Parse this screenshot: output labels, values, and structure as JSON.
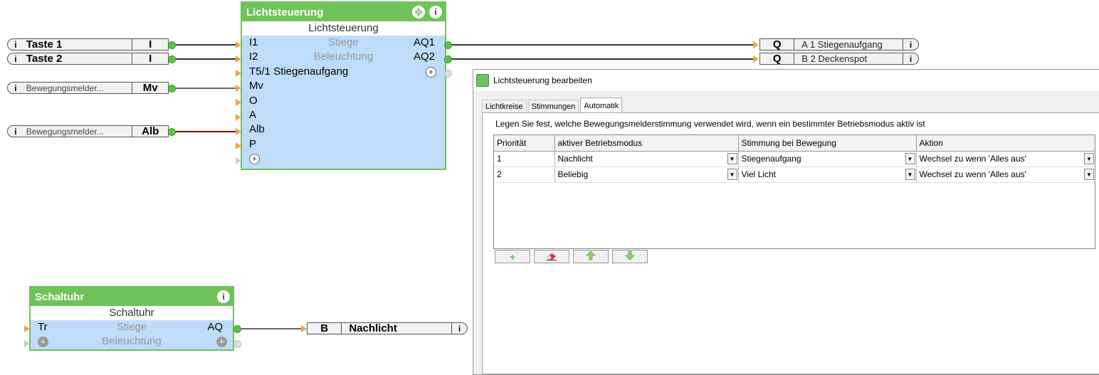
{
  "canvas": {
    "inputs": [
      {
        "name": "Taste 1",
        "port": "I"
      },
      {
        "name": "Taste 2",
        "port": "I"
      },
      {
        "name": "Bewegungsmelder...",
        "port": "Mv"
      },
      {
        "name": "Bewegungsmelder...",
        "port": "Alb"
      }
    ],
    "outputs": [
      {
        "port": "Q",
        "name": "A 1 Stiegenaufgang"
      },
      {
        "port": "Q",
        "name": "B 2 Deckenspot"
      },
      {
        "port": "B",
        "name": "Nachlicht"
      }
    ],
    "lichtsteuerung_block": {
      "header": "Lichtsteuerung",
      "title": "Lichtsteuerung",
      "rows": [
        {
          "left": "I1",
          "mid": "Stiege",
          "right": "AQ1"
        },
        {
          "left": "I2",
          "mid": "Beleuchtung",
          "right": "AQ2"
        },
        {
          "left": "T5/1 Stiegenaufgang",
          "mid": "",
          "right": "+"
        },
        {
          "left": "Mv",
          "mid": "",
          "right": ""
        },
        {
          "left": "O",
          "mid": "",
          "right": ""
        },
        {
          "left": "A",
          "mid": "",
          "right": ""
        },
        {
          "left": "Alb",
          "mid": "",
          "right": ""
        },
        {
          "left": "P",
          "mid": "",
          "right": ""
        },
        {
          "left": "+",
          "mid": "",
          "right": ""
        }
      ]
    },
    "schaltuhr_block": {
      "header": "Schaltuhr",
      "title": "Schaltuhr",
      "rows": [
        {
          "left": "Tr",
          "mid": "Stiege",
          "right": "AQ"
        },
        {
          "left": "+",
          "mid": "Beleuchtung",
          "right": "+"
        }
      ]
    },
    "icons": {
      "info": "info-icon",
      "move": "move-icon",
      "plus": "plus-icon"
    },
    "colors": {
      "block_green": "#6fc35a",
      "block_body": "#bfdcfb",
      "wire_alb": "#8b0000",
      "connector_orange": "#f0a44a"
    }
  },
  "dialog": {
    "title": "Lichtsteuerung bearbeiten",
    "tabs": [
      "Lichtkreise",
      "Stimmungen",
      "Automatik"
    ],
    "active_tab": "Automatik",
    "description": "Legen Sie fest, welche Bewegungsmelderstimmung verwendet wird, wenn ein bestimmter Betriebsmodus aktiv ist",
    "columns": [
      "Priorität",
      "aktiver Betriebsmodus",
      "Stimmung bei Bewegung",
      "Aktion"
    ],
    "rows": [
      [
        "1",
        "Nachlicht",
        "Stiegenaufgang",
        "Wechsel zu wenn 'Alles aus'"
      ],
      [
        "2",
        "Beliebig",
        "Viel Licht",
        "Wechsel zu wenn 'Alles aus'"
      ]
    ],
    "toolbar": {
      "add": "+",
      "buttons_icons": [
        "plus-icon",
        "eraser-icon",
        "arrow-up-icon",
        "arrow-down-icon"
      ]
    }
  }
}
